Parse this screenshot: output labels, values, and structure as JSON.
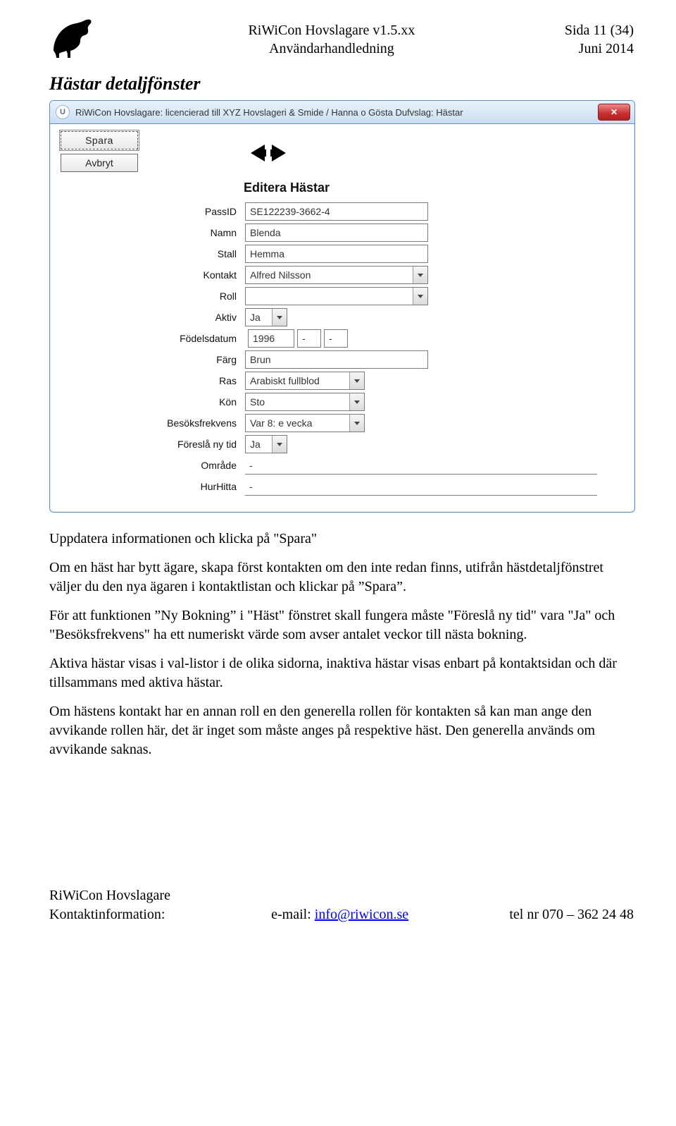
{
  "header": {
    "title1": "RiWiCon Hovslagare v1.5.xx",
    "title2": "Användarhandledning",
    "page": "Sida 11 (34)",
    "date": "Juni 2014"
  },
  "section_title": "Hästar detaljfönster",
  "window": {
    "title": "RiWiCon Hovslagare: licencierad till XYZ Hovslageri & Smide / Hanna o Gösta Dufvslag: Hästar",
    "buttons": {
      "spara": "Spara",
      "avbryt": "Avbryt"
    },
    "form_title": "Editera Hästar",
    "fields": {
      "passid": {
        "label": "PassID",
        "value": "SE122239-3662-4"
      },
      "namn": {
        "label": "Namn",
        "value": "Blenda"
      },
      "stall": {
        "label": "Stall",
        "value": "Hemma"
      },
      "kontakt": {
        "label": "Kontakt",
        "value": "Alfred Nilsson"
      },
      "roll": {
        "label": "Roll",
        "value": ""
      },
      "aktiv": {
        "label": "Aktiv",
        "value": "Ja"
      },
      "fodelsedatum": {
        "label": "Födelsdatum",
        "year": "1996",
        "month": "-",
        "day": "-"
      },
      "farg": {
        "label": "Färg",
        "value": "Brun"
      },
      "ras": {
        "label": "Ras",
        "value": "Arabiskt fullblod"
      },
      "kon": {
        "label": "Kön",
        "value": "Sto"
      },
      "besok": {
        "label": "Besöksfrekvens",
        "value": "Var 8: e vecka"
      },
      "foresla": {
        "label": "Föreslå ny tid",
        "value": "Ja"
      },
      "omrade": {
        "label": "Område",
        "value": "-"
      },
      "hurhitta": {
        "label": "HurHitta",
        "value": "-"
      }
    }
  },
  "paragraphs": {
    "p1": "Uppdatera informationen och klicka på \"Spara\"",
    "p2": "Om en häst har bytt ägare, skapa först kontakten om den inte redan finns, utifrån hästdetaljfönstret väljer du den nya ägaren i kontaktlistan och klickar på ”Spara”.",
    "p3": "För att funktionen ”Ny Bokning” i \"Häst\" fönstret skall fungera måste \"Föreslå ny tid\" vara \"Ja\" och \"Besöksfrekvens\" ha ett numeriskt värde som avser antalet veckor till nästa bokning.",
    "p4": "Aktiva hästar visas i val-listor i de olika sidorna, inaktiva hästar visas enbart på kontaktsidan och där tillsammans med aktiva hästar.",
    "p5": "Om hästens kontakt har en annan roll en den generella rollen för kontakten så kan man ange den avvikande rollen här, det är inget som måste anges på respektive häst. Den generella används om avvikande saknas."
  },
  "footer": {
    "left1": "RiWiCon Hovslagare",
    "left2": "Kontaktinformation:",
    "mid_label": "e-mail: ",
    "mid_link": "info@riwicon.se",
    "right": "tel nr 070 – 362 24 48"
  }
}
